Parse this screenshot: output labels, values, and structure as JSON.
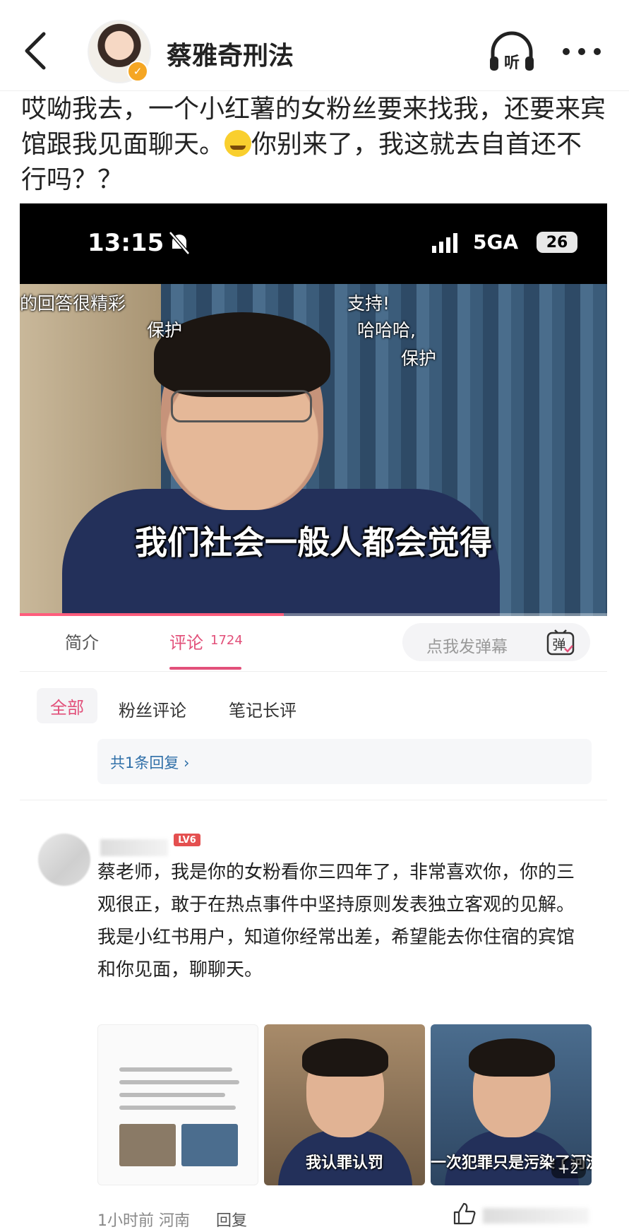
{
  "header": {
    "account_name": "蔡雅奇刑法",
    "listen_label": "听"
  },
  "post": {
    "text_part1": "哎呦我去，一个小红薯的女粉丝要来找我，还要来宾馆跟我见面聊天。",
    "text_part2": "你别来了，我这就去自首还不行吗？？",
    "emoji": "smirk-emoji"
  },
  "video": {
    "status_time": "13:15",
    "network": "5GA",
    "battery": "26",
    "danmaku": [
      "的回答很精彩",
      "保护",
      "支持!",
      "哈哈哈,",
      "保护"
    ],
    "subtitle": "我们社会一般人都会觉得",
    "progress": 0.45
  },
  "tabs": {
    "intro": "简介",
    "comments": "评论",
    "comments_count": "1724",
    "danmaku_placeholder": "点我发弹幕",
    "danmaku_icon": "弹"
  },
  "filters": {
    "all": "全部",
    "fans": "粉丝评论",
    "notes": "笔记长评"
  },
  "reply_summary": "共1条回复 ›",
  "comment": {
    "level": "LV6",
    "text_line1": "蔡老师，我是你的女粉看你三四年了，非常喜欢你，你的三观很正，敢于在热点事件中坚持原则发表独立客观的见解。",
    "text_line2": "我是小红书用户，知道你经常出差，希望能去你住宿的宾馆和你见面，聊聊天。",
    "image_captions": [
      "我认罪认罚",
      "一次犯罪只是污染了河流"
    ],
    "more_images": "+2",
    "meta": "1小时前 河南",
    "reply_action": "回复"
  },
  "colors": {
    "accent": "#e2507a",
    "link": "#2f6fa8",
    "verified": "#f5a623",
    "level_badge": "#e45050"
  }
}
